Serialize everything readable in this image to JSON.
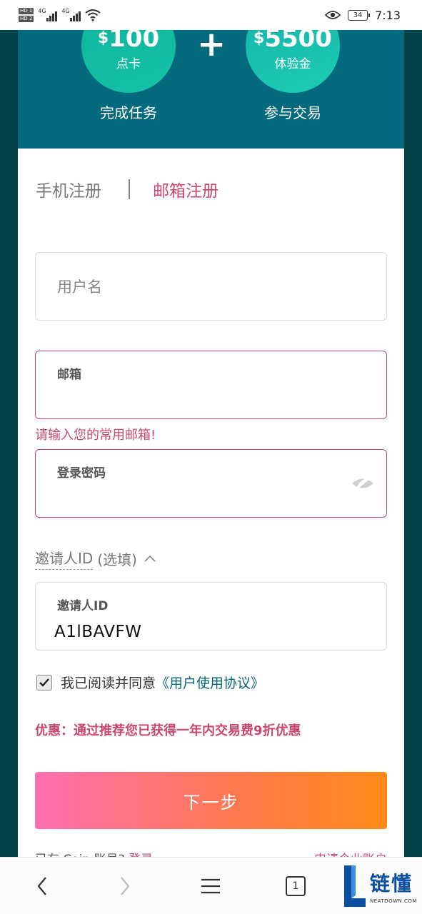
{
  "status_bar": {
    "sim1": "HD 1",
    "sim2": "HD 2",
    "net1": "4G",
    "net2": "4G",
    "battery": "34",
    "time": "7:13"
  },
  "banner": {
    "reward1_currency": "$",
    "reward1_amount": "100",
    "reward1_caption": "点卡",
    "plus": "+",
    "reward2_currency": "$",
    "reward2_amount": "5500",
    "reward2_caption": "体验金",
    "task1": "完成任务",
    "task2": "参与交易"
  },
  "tabs": {
    "phone": "手机注册",
    "email": "邮箱注册",
    "active": "email"
  },
  "form": {
    "username_placeholder": "用户名",
    "email_label": "邮箱",
    "email_value": "",
    "email_error": "请输入您的常用邮箱!",
    "password_label": "登录密码",
    "password_value": "",
    "invite_toggle_label": "邀请人ID",
    "invite_toggle_optional": "(选填)",
    "invite_label": "邀请人ID",
    "invite_value": "A1lBAVFW",
    "agree_text": "我已阅读并同意",
    "agree_link": "《用户使用协议》",
    "agree_checked": true,
    "promo": "优惠：通过推荐您已获得一年内交易费9折优惠",
    "next_button": "下一步"
  },
  "bottom_nav": {
    "tab_count": "1"
  },
  "watermark": {
    "title": "链懂",
    "site": "NEATDOWN.COM"
  },
  "colors": {
    "accent": "#c9496d",
    "banner": "#056a7d",
    "background": "#034048",
    "link": "#0b6676"
  }
}
